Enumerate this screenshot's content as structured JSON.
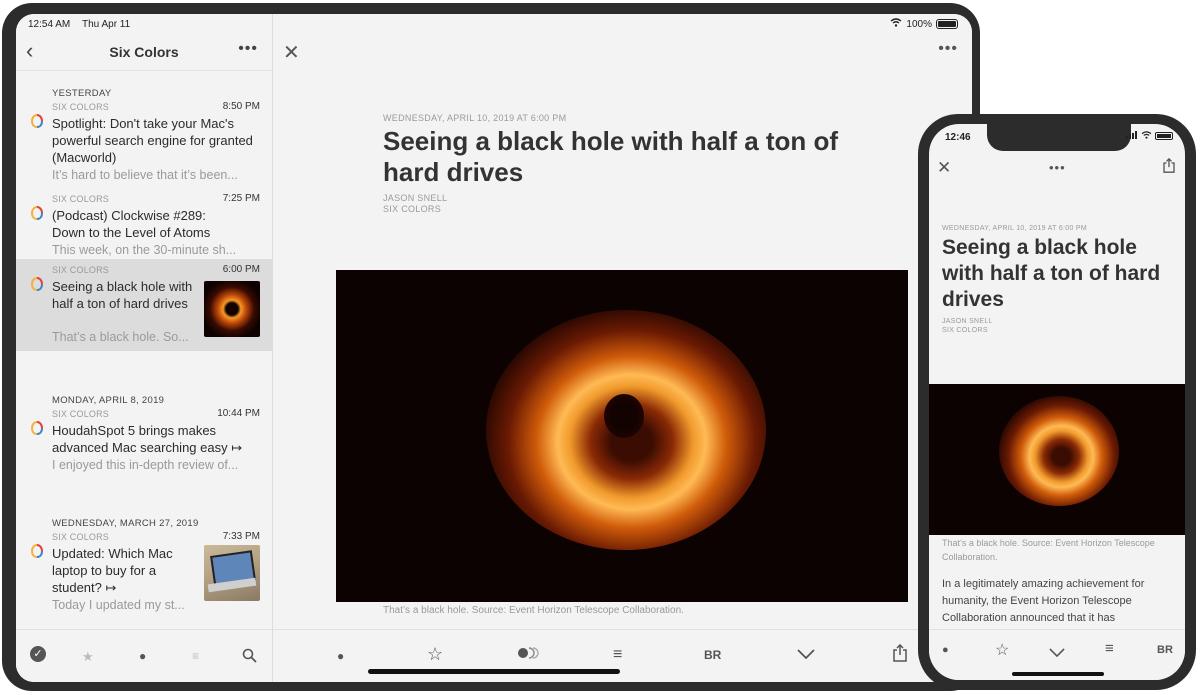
{
  "ipad": {
    "status": {
      "time": "12:54 AM",
      "date": "Thu Apr 11",
      "battery": "100%"
    },
    "sidebar": {
      "title": "Six Colors",
      "sections": [
        {
          "header": "YESTERDAY"
        },
        {
          "header": "MONDAY, APRIL 8, 2019"
        },
        {
          "header": "WEDNESDAY, MARCH 27, 2019"
        }
      ],
      "items": [
        {
          "source": "SIX COLORS",
          "time": "8:50 PM",
          "title": "Spotlight: Don't take your Mac's powerful search engine for granted (Macworld)",
          "excerpt": "It’s hard to believe that it’s been..."
        },
        {
          "source": "SIX COLORS",
          "time": "7:25 PM",
          "title": "(Podcast) Clockwise #289: Down to the Level of Atoms",
          "excerpt": "This week, on the 30-minute sh..."
        },
        {
          "source": "SIX COLORS",
          "time": "6:00 PM",
          "title": "Seeing a black hole with half a ton of hard drives",
          "excerpt": "That’s a black hole. So..."
        },
        {
          "source": "SIX COLORS",
          "time": "10:44 PM",
          "title": "HoudahSpot 5 brings makes advanced Mac searching easy ↦",
          "excerpt": "I enjoyed this in-depth review of..."
        },
        {
          "source": "SIX COLORS",
          "time": "7:33 PM",
          "title": "Updated: Which Mac laptop to buy for a student? ↦",
          "excerpt": "Today I updated my st..."
        }
      ]
    },
    "article": {
      "date": "WEDNESDAY, APRIL 10, 2019 AT 6:00 PM",
      "title": "Seeing a black hole with half a ton of hard drives",
      "author": "JASON SNELL",
      "source": "SIX COLORS",
      "caption": "That’s a black hole. Source: Event Horizon Telescope Collaboration."
    },
    "toolbar": {
      "br_label": "BR"
    }
  },
  "iphone": {
    "status": {
      "time": "12:46"
    },
    "article": {
      "date": "WEDNESDAY, APRIL 10, 2019 AT 6:00 PM",
      "title": "Seeing a black hole with half a ton of hard drives",
      "author": "JASON SNELL",
      "source": "SIX COLORS",
      "caption": "That’s a black hole. Source: Event Horizon Telescope Collaboration.",
      "body": "In a legitimately amazing achievement for humanity, the Event Horizon Telescope Collaboration announced that it has"
    },
    "toolbar": {
      "br_label": "BR"
    }
  },
  "icons": {
    "back": "chevron-left-icon",
    "more": "ellipsis-icon",
    "close": "close-icon",
    "share": "share-icon",
    "star": "star-icon",
    "unread": "unread-dot-icon",
    "search": "search-icon",
    "read-all": "checkmark-circle-icon",
    "reader": "reader-view-icon",
    "next": "chevron-down-icon"
  },
  "colors": {
    "background": "#f3f3f3",
    "device": "#2c2c2c",
    "selected": "#dcdcdc",
    "muted": "#9a9a9a"
  }
}
